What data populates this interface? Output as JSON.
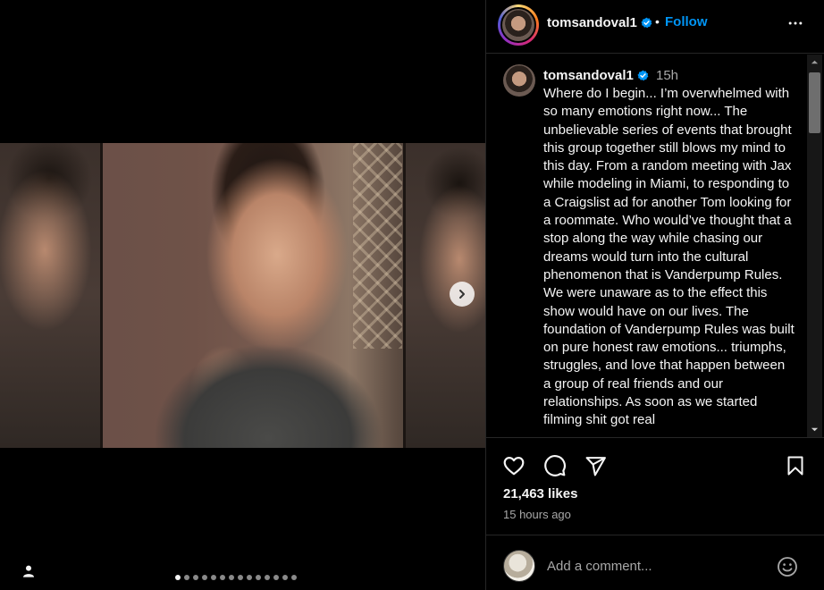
{
  "post": {
    "username": "tomsandoval1",
    "follow_label": "Follow",
    "separator": "•",
    "caption_time": "15h",
    "caption": "Where do I begin... I’m overwhelmed with so many emotions right now... The unbelievable series of events that brought this group together still blows my mind to this day. From a random meeting with Jax while modeling in Miami, to responding to a Craigslist ad for another Tom looking for a roommate. Who would’ve thought that a stop along the way while chasing our dreams would turn into the cultural phenomenon that is Vanderpump Rules. We were unaware as to the effect this show would have on our lives. The foundation of Vanderpump Rules was built on pure honest raw emotions... triumphs, struggles, and love that happen between a group of real friends and our relationships. As soon as we started filming shit got real",
    "likes": "21,463 likes",
    "posted_ago": "15 hours ago"
  },
  "comment_box": {
    "placeholder": "Add a comment..."
  },
  "carousel": {
    "slide_count": 14,
    "active_index": 0
  },
  "icons": {
    "verified": "verified-badge-icon",
    "more": "more-options-icon",
    "like": "heart-icon",
    "comment": "comment-icon",
    "share": "share-icon",
    "save": "bookmark-icon",
    "emoji": "emoji-icon",
    "next": "chevron-right-icon",
    "tags": "user-tag-icon"
  },
  "colors": {
    "background": "#000000",
    "link": "#0095f6",
    "verified": "#0095f6",
    "muted": "#a8a8a8"
  }
}
